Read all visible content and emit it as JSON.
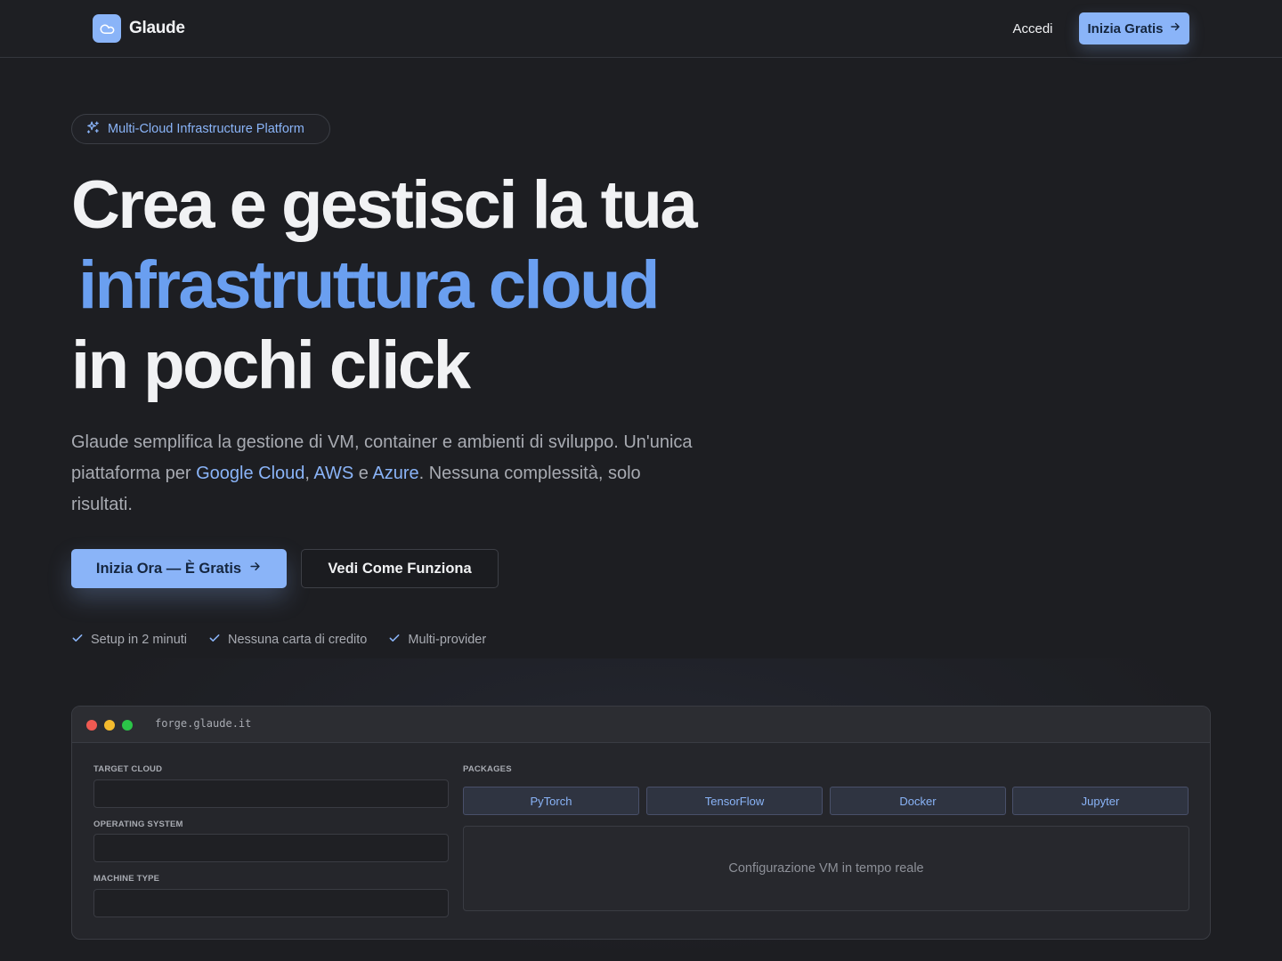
{
  "nav": {
    "brand": "Glaude",
    "login": "Accedi",
    "cta": "Inizia Gratis"
  },
  "hero": {
    "badge": "Multi-Cloud Infrastructure Platform",
    "headline_1": "Crea e gestisci la tua",
    "headline_2": "infrastruttura cloud",
    "headline_3": "in pochi click",
    "sub_1": "Glaude semplifica la gestione di VM, container e ambienti di sviluppo. Un'unica piattaforma per ",
    "sub_gcp": "Google Cloud",
    "sub_sep1": ", ",
    "sub_aws": "AWS",
    "sub_sep2": " e ",
    "sub_azure": "Azure",
    "sub_2": ". Nessuna complessità, solo risultati.",
    "primary_cta": "Inizia Ora — È Gratis",
    "secondary_cta": "Vedi Come Funziona",
    "features": [
      "Setup in 2 minuti",
      "Nessuna carta di credito",
      "Multi-provider"
    ]
  },
  "preview": {
    "url": "forge.glaude.it",
    "fields": {
      "target_cloud": "Target Cloud",
      "operating_system": "Operating System",
      "machine_type": "Machine Type"
    },
    "packages_label": "Packages",
    "packages": [
      "PyTorch",
      "TensorFlow",
      "Docker",
      "Jupyter"
    ],
    "config_text": "Configurazione VM in tempo reale"
  },
  "colors": {
    "accent": "#8ab4f8",
    "headline_accent": "#6a9ff0",
    "background": "#1d1e22"
  }
}
